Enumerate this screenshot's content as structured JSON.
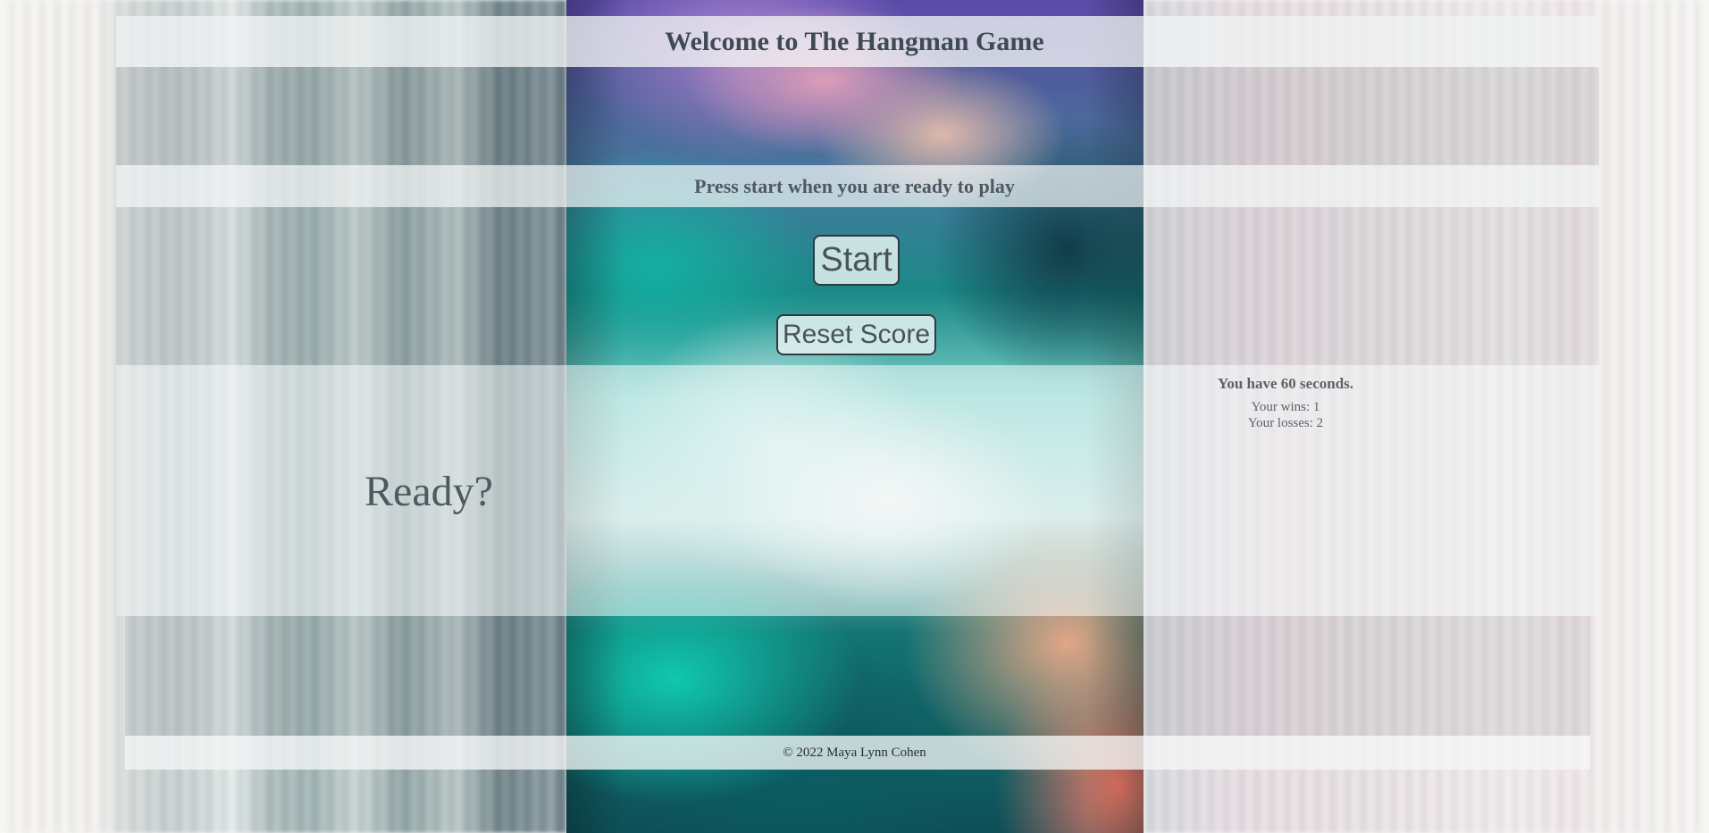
{
  "header": {
    "title": "Welcome to The Hangman Game",
    "subtitle": "Press start when you are ready to play"
  },
  "controls": {
    "start_label": "Start",
    "reset_label": "Reset Score"
  },
  "game": {
    "status": "Ready?"
  },
  "stats": {
    "timer": "You have 60 seconds.",
    "wins": "Your wins: 1",
    "losses": "Your losses: 2"
  },
  "footer": {
    "copyright": "© 2022 Maya Lynn Cohen"
  }
}
